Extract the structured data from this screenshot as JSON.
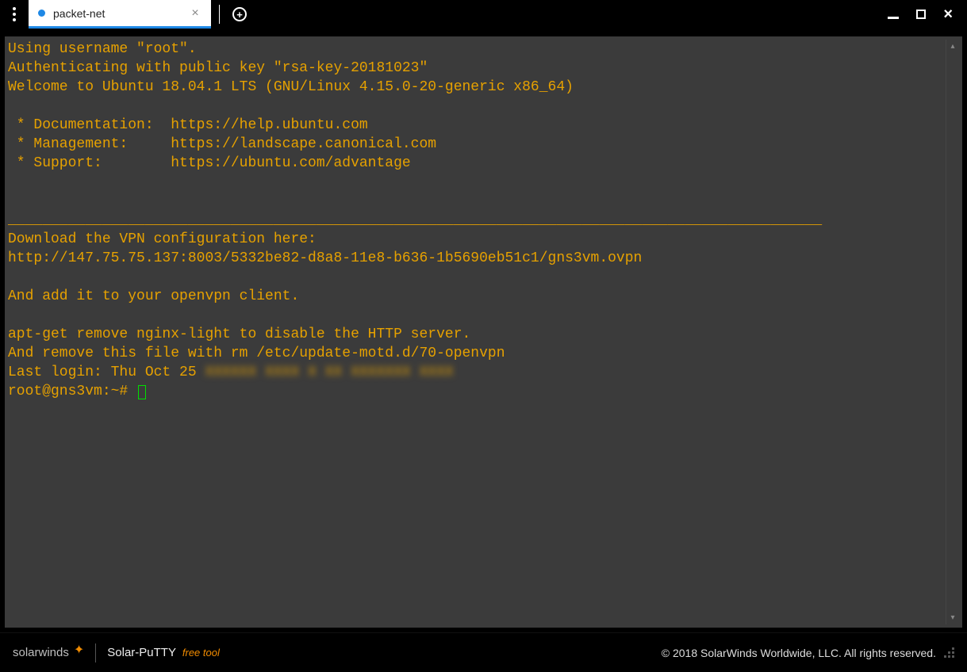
{
  "tab": {
    "title": "packet-net"
  },
  "terminal": {
    "lines": [
      "Using username \"root\".",
      "Authenticating with public key \"rsa-key-20181023\"",
      "Welcome to Ubuntu 18.04.1 LTS (GNU/Linux 4.15.0-20-generic x86_64)",
      "",
      " * Documentation:  https://help.ubuntu.com",
      " * Management:     https://landscape.canonical.com",
      " * Support:        https://ubuntu.com/advantage",
      "",
      "",
      "_______________________________________________________________________________________________",
      "Download the VPN configuration here:",
      "http://147.75.75.137:8003/5332be82-d8a8-11e8-b636-1b5690eb51c1/gns3vm.ovpn",
      "",
      "And add it to your openvpn client.",
      "",
      "apt-get remove nginx-light to disable the HTTP server.",
      "And remove this file with rm /etc/update-motd.d/70-openvpn"
    ],
    "last_login_prefix": "Last login: Thu Oct 25 ",
    "last_login_blurred": "XXXXXX XXXX X XX XXXXXXX XXXX",
    "prompt": "root@gns3vm:~# "
  },
  "footer": {
    "brand": "solarwinds",
    "app": "Solar-PuTTY",
    "tagline": "free tool",
    "copyright": "© 2018 SolarWinds Worldwide, LLC. All rights reserved."
  }
}
